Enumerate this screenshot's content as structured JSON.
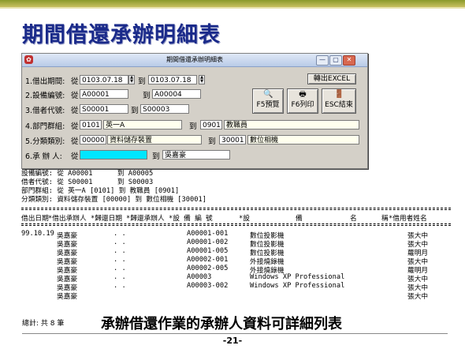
{
  "slide": {
    "title": "期間借還承辦明細表",
    "caption": "承辦借還作業的承辦人資料可詳細列表",
    "page_number": "-21-"
  },
  "window": {
    "title": "期間借還承辦明細表",
    "controls": [
      "—",
      "▢",
      "✕"
    ],
    "export_button": "轉出EXCEL",
    "buttons": [
      "F5預覽",
      "F6列印",
      "ESC結束"
    ],
    "fields": [
      {
        "label": "1.借出期間:",
        "from_label": "從",
        "from": "0103.07.18",
        "to_label": "到",
        "to": "0103.07.18"
      },
      {
        "label": "2.設備編號:",
        "from_label": "從",
        "from": "A00001",
        "to_label": "到",
        "to": "A00004"
      },
      {
        "label": "3.借者代號:",
        "from_label": "從",
        "from": "S00001",
        "to_label": "到",
        "to": "S00003"
      },
      {
        "label": "4.部門群組:",
        "from_label": "從",
        "from": "0101",
        "from_name": "英一A",
        "to_label": "到",
        "to": "0901",
        "to_name": "教職員"
      },
      {
        "label": "5.分類類別:",
        "from_label": "從",
        "from": "00000",
        "from_name": "資料儲存裝置",
        "to_label": "到",
        "to": "30001",
        "to_name": "數位相機"
      },
      {
        "label": "6.承 辦 人:",
        "from_label": "從",
        "from": "",
        "to_label": "到",
        "to": "吳嘉豪"
      }
    ]
  },
  "report": {
    "filters": [
      "設備編號: 從 A00001      到 A00005",
      "借者代號: 從 S00001      到 S00003",
      "部門群組: 從 英一A [0101] 到 教職員 [0901]",
      "分類類別: 資料儲存裝置 [00000] 到 數位相機 [30001]"
    ],
    "headers": [
      "借出日期",
      "*借出承辦人",
      "*歸還日期",
      "*歸還承辦人",
      "*設  備  編  號",
      "*設",
      "備",
      "名",
      "稱",
      "*借用者姓名"
    ],
    "rows": [
      {
        "date": "99.10.19",
        "lender": "吳嘉豪",
        "return_date": ". .",
        "equip_no": "A00001-001",
        "equip_name": "數位投影機",
        "borrower": "張大中"
      },
      {
        "date": "",
        "lender": "吳嘉豪",
        "return_date": ". .",
        "equip_no": "A00001-002",
        "equip_name": "數位投影機",
        "borrower": "張大中"
      },
      {
        "date": "",
        "lender": "吳嘉豪",
        "return_date": ". .",
        "equip_no": "A00001-005",
        "equip_name": "數位投影機",
        "borrower": "蘿明月"
      },
      {
        "date": "",
        "lender": "吳嘉豪",
        "return_date": ". .",
        "equip_no": "A00002-001",
        "equip_name": "外接燒錄機",
        "borrower": "張大中"
      },
      {
        "date": "",
        "lender": "吳嘉豪",
        "return_date": ". .",
        "equip_no": "A00002-005",
        "equip_name": "外接燒錄機",
        "borrower": "蘿明月"
      },
      {
        "date": "",
        "lender": "吳嘉豪",
        "return_date": ". .",
        "equip_no": "A00003",
        "equip_name": "Windows XP Professional",
        "borrower": "張大中"
      },
      {
        "date": "",
        "lender": "吳嘉豪",
        "return_date": ". .",
        "equip_no": "A00003-002",
        "equip_name": "Windows XP Professional",
        "borrower": "張大中"
      },
      {
        "date": "",
        "lender": "吳嘉豪",
        "return_date": "",
        "equip_no": "",
        "equip_name": "",
        "borrower": "張大中"
      }
    ],
    "total": "總計: 共 8 筆"
  }
}
